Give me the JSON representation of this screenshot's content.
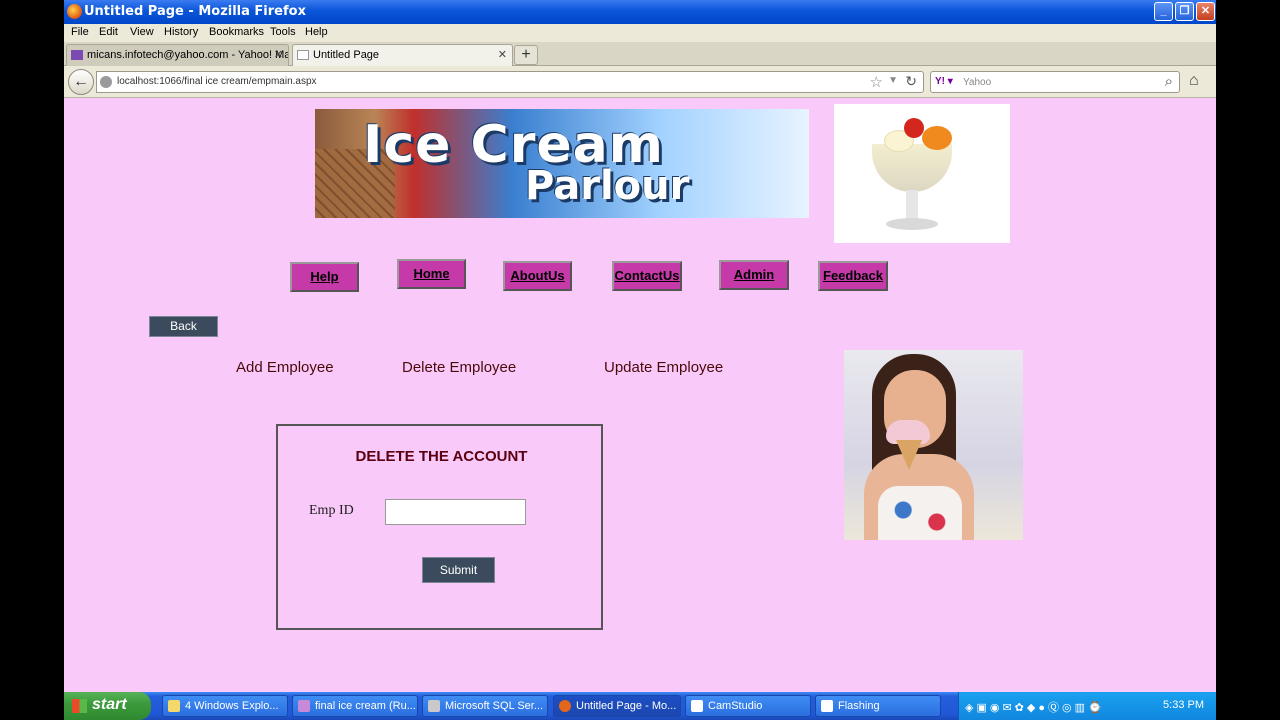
{
  "window": {
    "title": "Untitled Page - Mozilla Firefox"
  },
  "menu": [
    "File",
    "Edit",
    "View",
    "History",
    "Bookmarks",
    "Tools",
    "Help"
  ],
  "tabs": [
    {
      "label": "micans.infotech@yahoo.com - Yahoo! Mail"
    },
    {
      "label": "Untitled Page"
    }
  ],
  "address": {
    "url": "localhost:1066/final ice cream/empmain.aspx"
  },
  "search": {
    "placeholder": "Yahoo"
  },
  "banner": {
    "line1": "Ice Cream",
    "line2": "Parlour"
  },
  "nav": [
    "Help",
    "Home",
    "AboutUs",
    "ContactUs",
    "Admin",
    "Feedback"
  ],
  "back_label": "Back",
  "employee_links": [
    "Add Employee",
    "Delete Employee",
    "Update Employee"
  ],
  "delete_panel": {
    "title": "DELETE THE ACCOUNT",
    "emp_label": "Emp ID",
    "emp_value": "",
    "submit_label": "Submit"
  },
  "taskbar": {
    "start_label": "start",
    "items": [
      "4 Windows Explo...",
      "final ice cream (Ru...",
      "Microsoft SQL Ser...",
      "Untitled Page - Mo...",
      "CamStudio",
      "Flashing"
    ],
    "clock": "5:33 PM"
  },
  "colors": {
    "page_bg": "#f9c9f9",
    "nav_button": "#c53aa8",
    "dark_button": "#3b4b5d",
    "link_text": "#4a0a0a"
  }
}
